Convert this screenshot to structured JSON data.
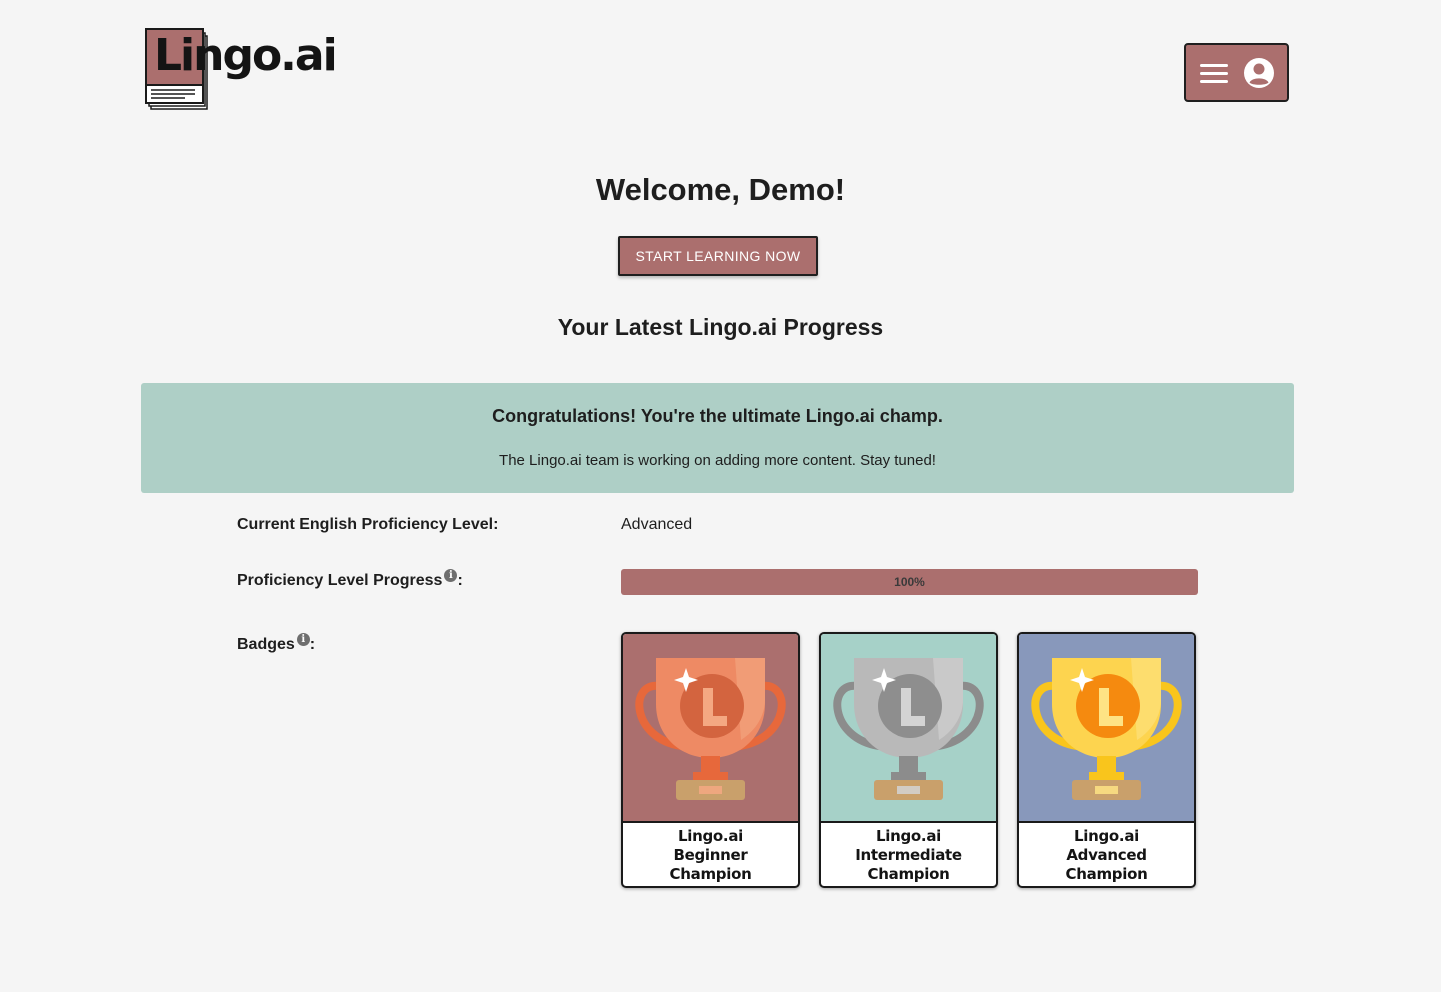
{
  "header": {
    "logo_text": "Lingo.ai",
    "menu_icon": "hamburger-menu-icon",
    "account_icon": "user-circle-icon"
  },
  "welcome": {
    "title": "Welcome, Demo!",
    "start_button": "START LEARNING NOW"
  },
  "progress": {
    "heading": "Your Latest Lingo.ai Progress",
    "banner_title": "Congratulations! You're the ultimate Lingo.ai champ.",
    "banner_subtitle": "The Lingo.ai team is working on adding more content. Stay tuned!",
    "level_label": "Current English Proficiency Level:",
    "level_value": "Advanced",
    "level_progress_label": "Proficiency Level Progress",
    "level_progress_value": 100,
    "level_progress_text": "100%",
    "badges_label": "Badges",
    "colon": ":",
    "info_icon": "info-icon"
  },
  "badges": [
    {
      "line1": "Lingo.ai",
      "line2": "Beginner",
      "line3": "Champion",
      "bg": "#ab6f6e",
      "trophy": "#ee8a64",
      "trophy_light": "#f4a882",
      "emblem": "#d3643f",
      "stem": "#e7683b",
      "icon": "bronze-trophy-icon"
    },
    {
      "line1": "Lingo.ai",
      "line2": "Intermediate",
      "line3": "Champion",
      "bg": "#a6d1c8",
      "trophy": "#b9b9b9",
      "trophy_light": "#d4d4d4",
      "emblem": "#8e8e8e",
      "stem": "#8c8c8c",
      "icon": "silver-trophy-icon"
    },
    {
      "line1": "Lingo.ai",
      "line2": "Advanced",
      "line3": "Champion",
      "bg": "#8898bb",
      "trophy": "#fdd44f",
      "trophy_light": "#fee384",
      "emblem": "#f58a0f",
      "stem": "#f9c51c",
      "icon": "gold-trophy-icon"
    }
  ],
  "colors": {
    "background": "#f5f5f5",
    "accent": "#ab6f6e",
    "banner": "#aecfc6",
    "text": "#1e1e1e",
    "pedestal": "#c9a06b"
  }
}
